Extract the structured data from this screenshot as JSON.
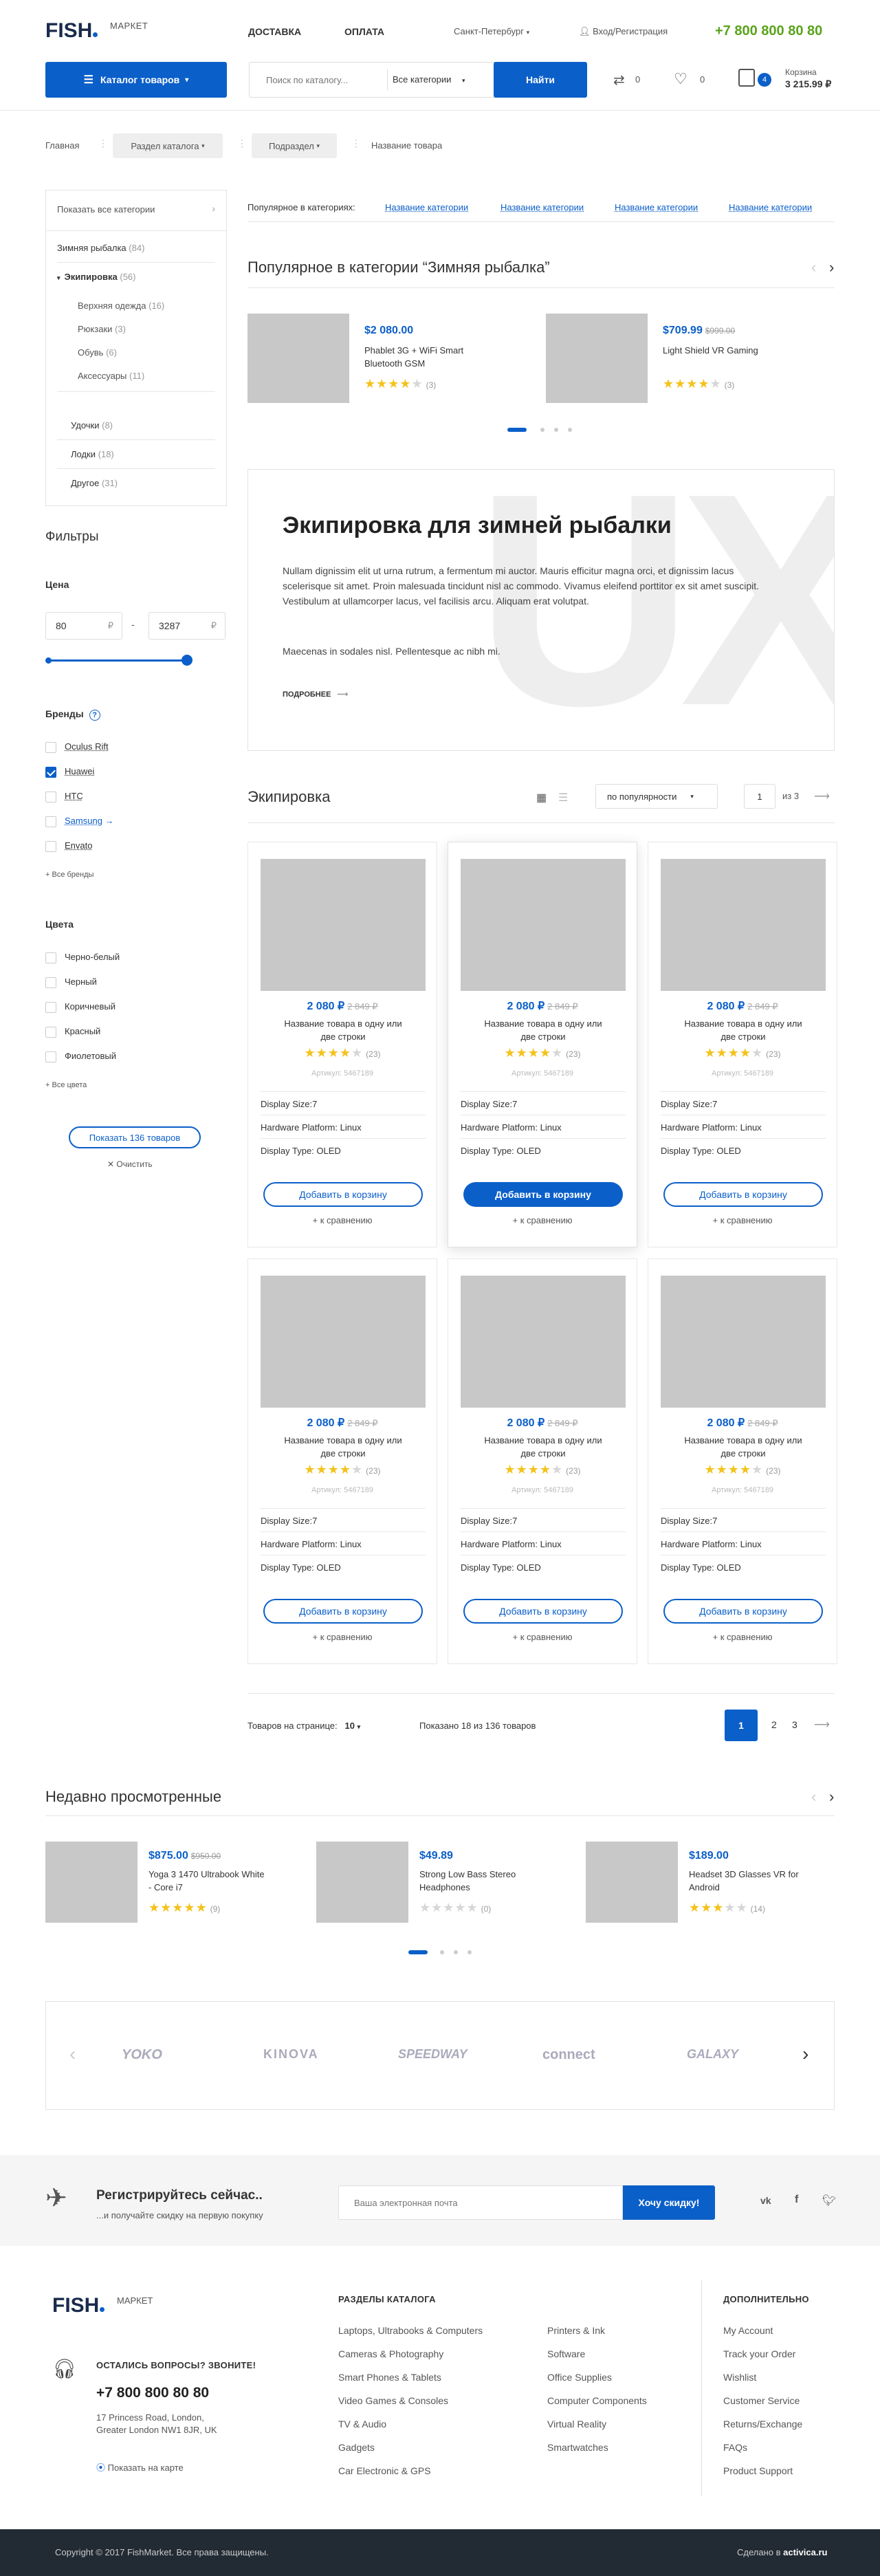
{
  "header": {
    "logo_main": "FISH",
    "logo_sub": "МАРКЕТ",
    "nav": [
      "ДОСТАВКА",
      "ОПЛАТА"
    ],
    "city": "Санкт-Петербург",
    "login": "Вход/Регистрация",
    "phone": "+7 800 800 80 80"
  },
  "bar": {
    "catalog_btn": "Каталог товаров",
    "search_placeholder": "Поиск по каталогу...",
    "search_cat": "Все категории",
    "search_btn": "Найти",
    "compare_count": "0",
    "fav_count": "0",
    "cart_badge": "4",
    "cart_label": "Корзина",
    "cart_sum": "3 215.99 ₽"
  },
  "breadcrumbs": [
    "Главная",
    "Раздел каталога",
    "Подраздел",
    "Название товара"
  ],
  "sidebar": {
    "show_all": "Показать все категории",
    "cats": [
      {
        "label": "Зимняя рыбалка",
        "count": "(84)"
      },
      {
        "label": "Экипировка",
        "count": "(56)"
      },
      {
        "label": "Верхняя одежда",
        "count": "(16)"
      },
      {
        "label": "Рюкзаки",
        "count": "(3)"
      },
      {
        "label": "Обувь",
        "count": "(6)"
      },
      {
        "label": "Аксессуары",
        "count": "(11)"
      },
      {
        "label": "Удочки",
        "count": "(8)"
      },
      {
        "label": "Лодки",
        "count": "(18)"
      },
      {
        "label": "Другое",
        "count": "(31)"
      }
    ],
    "filters_title": "Фильтры",
    "price_label": "Цена",
    "price_from": "80",
    "price_to": "3287",
    "currency": "₽",
    "brands_title": "Бренды",
    "brands": [
      "Oculus Rift",
      "Huawei",
      "HTC",
      "Samsung",
      "Envato"
    ],
    "brands_more": "+ Все бренды",
    "colors_title": "Цвета",
    "colors": [
      "Черно-белый",
      "Черный",
      "Коричневый",
      "Красный",
      "Фиолетовый"
    ],
    "colors_more": "+ Все цвета",
    "show_btn": "Показать 136 товаров",
    "clear": "Очистить"
  },
  "popular_in": {
    "label": "Популярное в категориях:",
    "links": [
      "Название категории",
      "Название категории",
      "Название категории",
      "Название категории"
    ]
  },
  "popular": {
    "title": "Популярное в категории “Зимняя рыбалка”",
    "items": [
      {
        "price": "$2 080.00",
        "old": "",
        "name": "Phablet 3G + WiFi Smart Bluetooth GSM",
        "count": "(3)",
        "stars": 4
      },
      {
        "price": "$709.99",
        "old": "$999.00",
        "name": "Light Shield VR Gaming",
        "count": "(3)",
        "stars": 4
      }
    ]
  },
  "promo": {
    "bg": "UX",
    "title": "Экипировка для зимней рыбалки",
    "text1": "Nullam dignissim elit ut urna rutrum, a fermentum mi auctor. Mauris efficitur magna orci, et dignissim lacus scelerisque sit amet. Proin malesuada tincidunt nisl ac commodo. Vivamus eleifend porttitor ex sit amet suscipit. Vestibulum at ullamcorper lacus, vel facilisis arcu. Aliquam erat volutpat.",
    "text2": "Maecenas in sodales nisl. Pellentesque ac nibh mi.",
    "more": "ПОДРОБНЕЕ"
  },
  "catalog": {
    "title": "Экипировка",
    "sort": "по популярности",
    "page": "1",
    "of": "из",
    "pages": "3"
  },
  "product": {
    "price": "2 080 ₽",
    "old": "2 849 ₽",
    "name": "Название товара в одну или две строки",
    "count": "(23)",
    "art": "Артикул: 5467189",
    "spec1": "Display Size:7",
    "spec2": "Hardware Platform: Linux",
    "spec3": "Display Type: OLED",
    "add": "Добавить в корзину",
    "compare": "+ к сравнению"
  },
  "pager": {
    "per_page_label": "Товаров на странице:",
    "per_page": "10",
    "shown": "Показано 18 из 136 товаров",
    "pages": [
      "1",
      "2",
      "3"
    ]
  },
  "recent": {
    "title": "Недавно просмотренные",
    "items": [
      {
        "price": "$875.00",
        "old": "$950.00",
        "name": "Yoga 3 1470 Ultrabook White - Core i7",
        "count": "(9)",
        "stars": 5
      },
      {
        "price": "$49.89",
        "old": "",
        "name": "Strong Low Bass Stereo Headphones",
        "count": "(0)",
        "stars": 0
      },
      {
        "price": "$189.00",
        "old": "",
        "name": "Headset 3D Glasses VR for Android",
        "count": "(14)",
        "stars": 3
      }
    ]
  },
  "brands_logos": [
    "YOKO",
    "KINOVA",
    "SPEEDWAY",
    "connect",
    "GALAXY"
  ],
  "subscribe": {
    "title": "Регистрируйтесь сейчас..",
    "sub": "...и получайте скидку на первую покупку",
    "placeholder": "Ваша электронная почта",
    "btn": "Хочу скидку!"
  },
  "footer": {
    "question": "ОСТАЛИСЬ ВОПРОСЫ? ЗВОНИТЕ!",
    "phone": "+7 800 800 80 80",
    "addr1": "17 Princess Road, London,",
    "addr2": "Greater London NW1 8JR, UK",
    "map": "Показать на карте",
    "col_title": "РАЗДЕЛЫ КАТАЛОГА",
    "col1": [
      "Laptops, Ultrabooks & Computers",
      "Cameras & Photography",
      "Smart Phones & Tablets",
      "Video Games & Consoles",
      "TV & Audio",
      "Gadgets",
      "Car Electronic & GPS"
    ],
    "col2": [
      "Printers & Ink",
      "Software",
      "Office Supplies",
      "Computer Components",
      "Virtual Reality",
      "Smartwatches"
    ],
    "extra_title": "ДОПОЛНИТЕЛЬНО",
    "extra": [
      "My Account",
      "Track your Order",
      "Wishlist",
      "Customer Service",
      "Returns/Exchange",
      "FAQs",
      "Product Support"
    ],
    "copyright": "Copyright © 2017 FishMarket. Все права защищены.",
    "made_by": "Сделано в",
    "made_brand": "activica.ru"
  }
}
